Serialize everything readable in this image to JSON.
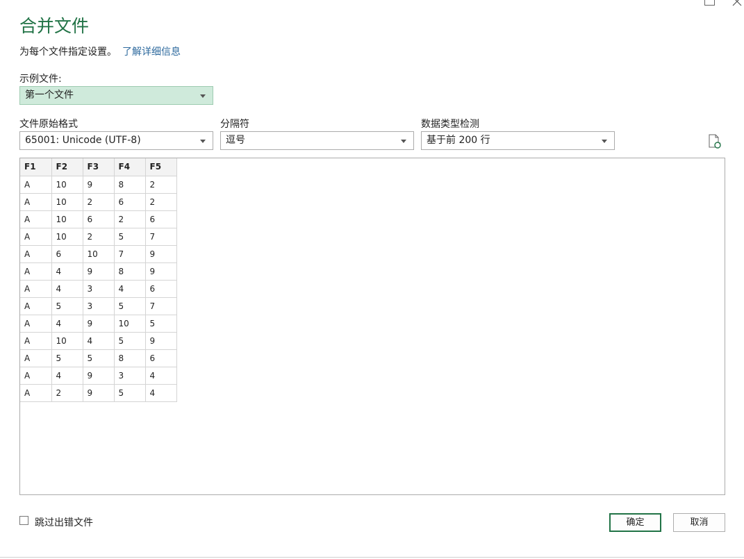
{
  "dialog": {
    "title": "合并文件",
    "subtitle": "为每个文件指定设置。",
    "learn_more": "了解详细信息"
  },
  "sample": {
    "label": "示例文件:",
    "value": "第一个文件"
  },
  "settings": {
    "origin_label": "文件原始格式",
    "origin_value": "65001: Unicode (UTF-8)",
    "delimiter_label": "分隔符",
    "delimiter_value": "逗号",
    "detect_label": "数据类型检测",
    "detect_value": "基于前 200 行"
  },
  "preview": {
    "columns": [
      "F1",
      "F2",
      "F3",
      "F4",
      "F5"
    ],
    "rows": [
      [
        "A",
        "10",
        "9",
        "8",
        "2"
      ],
      [
        "A",
        "10",
        "2",
        "6",
        "2"
      ],
      [
        "A",
        "10",
        "6",
        "2",
        "6"
      ],
      [
        "A",
        "10",
        "2",
        "5",
        "7"
      ],
      [
        "A",
        "6",
        "10",
        "7",
        "9"
      ],
      [
        "A",
        "4",
        "9",
        "8",
        "9"
      ],
      [
        "A",
        "4",
        "3",
        "4",
        "6"
      ],
      [
        "A",
        "5",
        "3",
        "5",
        "7"
      ],
      [
        "A",
        "4",
        "9",
        "10",
        "5"
      ],
      [
        "A",
        "10",
        "4",
        "5",
        "9"
      ],
      [
        "A",
        "5",
        "5",
        "8",
        "6"
      ],
      [
        "A",
        "4",
        "9",
        "3",
        "4"
      ],
      [
        "A",
        "2",
        "9",
        "5",
        "4"
      ]
    ]
  },
  "footer": {
    "skip_label": "跳过出错文件",
    "skip_checked": false,
    "ok_label": "确定",
    "cancel_label": "取消"
  },
  "colors": {
    "accent": "#217346",
    "link": "#2e6a9e",
    "sample_bg": "#cfeadb"
  }
}
